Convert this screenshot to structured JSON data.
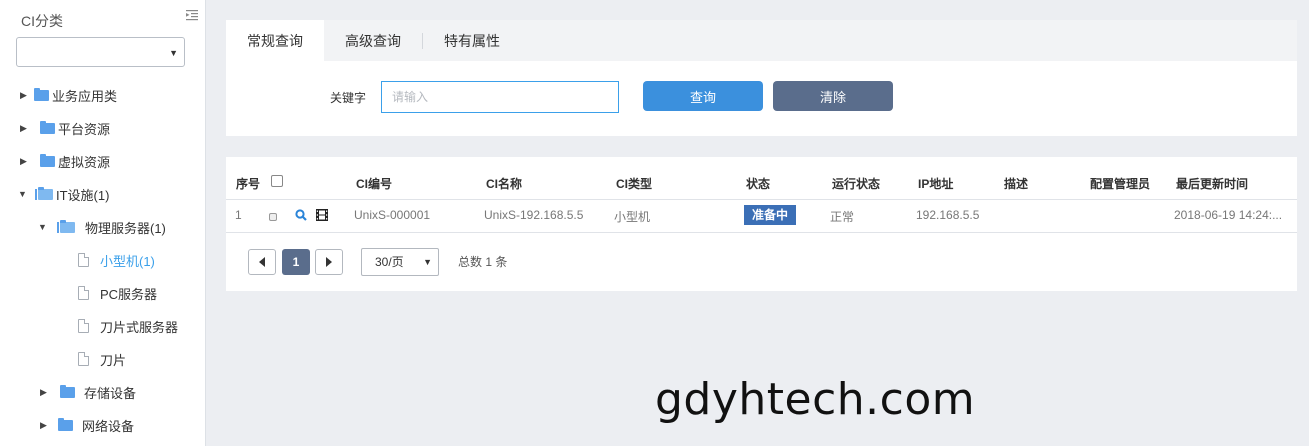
{
  "sidebar": {
    "title": "CI分类",
    "category_select": {
      "value": ""
    },
    "tree": [
      {
        "label": "业务应用类",
        "type": "folder",
        "state": "collapsed"
      },
      {
        "label": "平台资源",
        "type": "folder",
        "state": "collapsed"
      },
      {
        "label": "虚拟资源",
        "type": "folder",
        "state": "collapsed"
      },
      {
        "label": "IT设施(1)",
        "type": "folder",
        "state": "expanded"
      },
      {
        "label": "物理服务器(1)",
        "type": "folder",
        "state": "expanded"
      },
      {
        "label": "小型机(1)",
        "type": "file",
        "state": "selected"
      },
      {
        "label": "PC服务器",
        "type": "file",
        "state": ""
      },
      {
        "label": "刀片式服务器",
        "type": "file",
        "state": ""
      },
      {
        "label": "刀片",
        "type": "file",
        "state": ""
      },
      {
        "label": "存储设备",
        "type": "folder",
        "state": "collapsed"
      },
      {
        "label": "网络设备",
        "type": "folder",
        "state": "collapsed"
      }
    ]
  },
  "search": {
    "tabs": [
      "常规查询",
      "高级查询",
      "特有属性"
    ],
    "active_tab": "常规查询",
    "keyword_label": "关键字",
    "keyword_value": "",
    "keyword_placeholder": "请输入",
    "query_button": "查询",
    "clear_button": "清除"
  },
  "table": {
    "columns": [
      "序号",
      "CI编号",
      "CI名称",
      "CI类型",
      "状态",
      "运行状态",
      "IP地址",
      "描述",
      "配置管理员",
      "最后更新时间"
    ],
    "rows": [
      {
        "index": "1",
        "ci_id": "UnixS-000001",
        "ci_name": "UnixS-192.168.5.5",
        "ci_type": "小型机",
        "status": "准备中",
        "run_status": "正常",
        "ip": "192.168.5.5",
        "description": "",
        "admin": "",
        "updated": "2018-06-19 14:24:..."
      }
    ],
    "row_icons": [
      "search-icon",
      "film-icon"
    ]
  },
  "pagination": {
    "current_page": "1",
    "page_size": "30/页",
    "total": "总数 1 条"
  },
  "watermark": "gdyhtech.com",
  "colors": {
    "accent": "#3b90dd",
    "clear_button": "#5a6d8c",
    "status_badge": "#3b6fb6",
    "folder": "#5aa0ea",
    "selected_item": "#3ba0ea"
  }
}
